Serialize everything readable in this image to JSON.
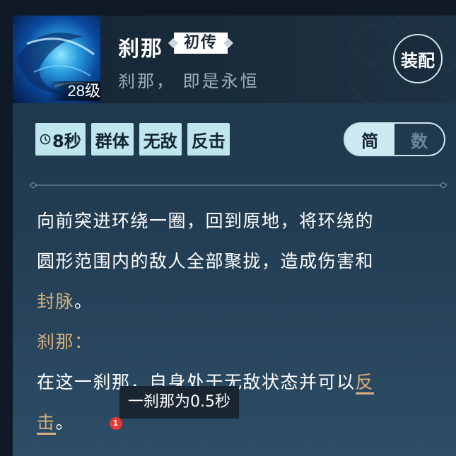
{
  "skill": {
    "name": "刹那",
    "rank": "初传",
    "motto": "刹那， 即是永恒",
    "level": "28级"
  },
  "equip_label": "装配",
  "tags": {
    "cooldown": "8秒",
    "target": "群体",
    "invincible": "无敌",
    "counter": "反击"
  },
  "toggle": {
    "simple": "简",
    "numeric": "数",
    "selected": "简"
  },
  "description": {
    "line1": "向前突进环绕一圈，回到原地，将环绕的",
    "line2": "圆形范围内的敌人全部聚拢，造成伤害和",
    "line3_kw": "封脉",
    "line3_end": "。",
    "sub_title": "刹那：",
    "line4_start": "在这一刹那，自身处于无敌状态并可以",
    "line4_kw": "反",
    "line5_kw": "击",
    "line5_end": "。",
    "note_number": "1"
  },
  "tooltip": "一刹那为0.5秒",
  "colors": {
    "accent_gold": "#d6b07a",
    "tag_bg": "#bfe6ef",
    "note_red": "#e53935"
  },
  "icons": [
    "clock-icon",
    "skill-icon"
  ]
}
